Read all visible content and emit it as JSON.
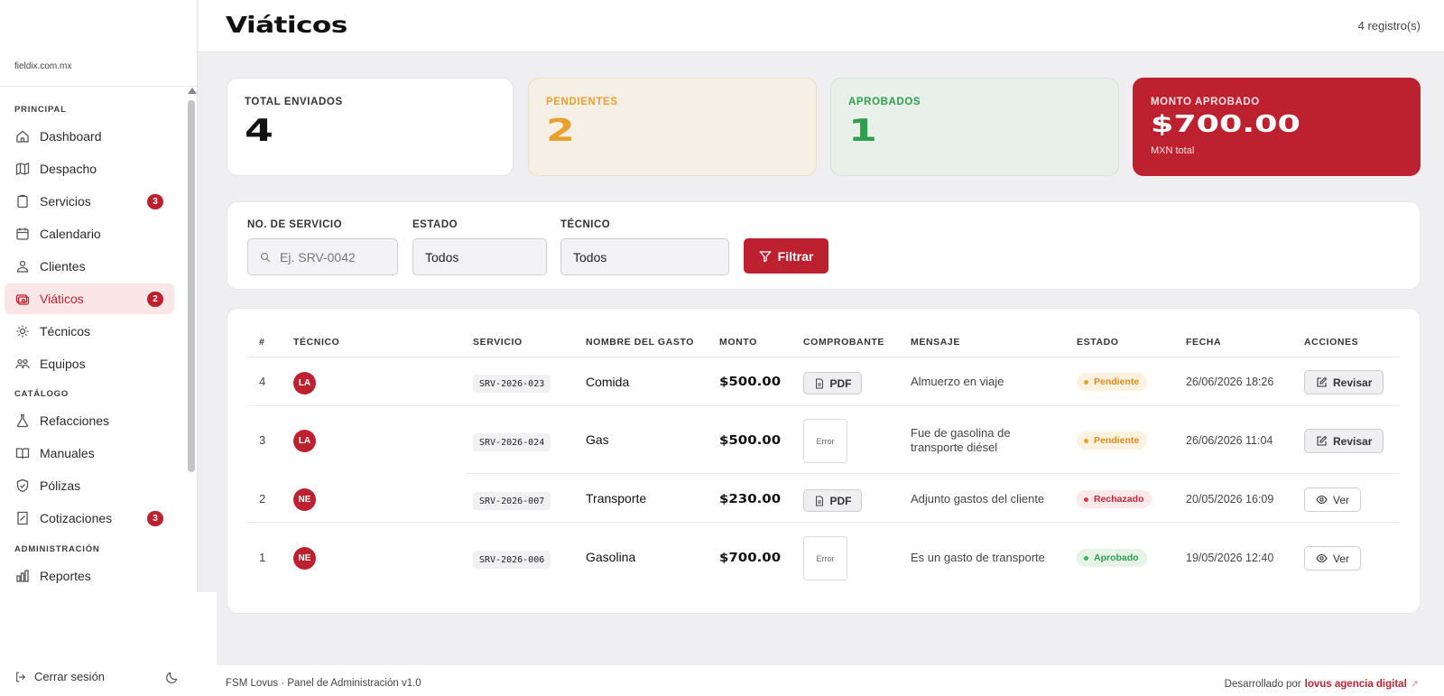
{
  "sidebar": {
    "domain": "fieldix.com.mx",
    "sections": {
      "principal": "PRINCIPAL",
      "catalogo": "CATÁLOGO",
      "administracion": "ADMINISTRACIÓN"
    },
    "items": [
      {
        "label": "Dashboard",
        "icon": "home-icon"
      },
      {
        "label": "Despacho",
        "icon": "map-icon"
      },
      {
        "label": "Servicios",
        "icon": "clipboard-icon",
        "badge": "3"
      },
      {
        "label": "Calendario",
        "icon": "calendar-icon"
      },
      {
        "label": "Clientes",
        "icon": "users-icon"
      },
      {
        "label": "Viáticos",
        "icon": "money-icon",
        "badge": "2",
        "active": true
      },
      {
        "label": "Técnicos",
        "icon": "gear-icon"
      },
      {
        "label": "Equipos",
        "icon": "team-icon"
      },
      {
        "label": "Refacciones",
        "icon": "flask-icon"
      },
      {
        "label": "Manuales",
        "icon": "book-icon"
      },
      {
        "label": "Pólizas",
        "icon": "shield-icon"
      },
      {
        "label": "Cotizaciones",
        "icon": "invoice-icon",
        "badge": "3"
      },
      {
        "label": "Reportes",
        "icon": "chart-icon"
      }
    ],
    "logout_label": "Cerrar sesión"
  },
  "header": {
    "title": "Viáticos",
    "record_count": "4 registro(s)"
  },
  "stats": {
    "total": {
      "label": "TOTAL ENVIADOS",
      "value": "4"
    },
    "pendientes": {
      "label": "PENDIENTES",
      "value": "2"
    },
    "aprobados": {
      "label": "APROBADOS",
      "value": "1"
    },
    "monto": {
      "label": "MONTO APROBADO",
      "value": "$700.00",
      "sub": "MXN total"
    }
  },
  "filters": {
    "servicio_label": "NO. DE SERVICIO",
    "servicio_placeholder": "Ej. SRV-0042",
    "estado_label": "ESTADO",
    "estado_value": "Todos",
    "tecnico_label": "TÉCNICO",
    "tecnico_value": "Todos",
    "button_label": "Filtrar"
  },
  "table": {
    "headers": [
      "#",
      "TÉCNICO",
      "SERVICIO",
      "NOMBRE DEL GASTO",
      "MONTO",
      "COMPROBANTE",
      "MENSAJE",
      "ESTADO",
      "FECHA",
      "ACCIONES"
    ],
    "rows": [
      {
        "num": "4",
        "tech": "LA",
        "service": "SRV-2026-023",
        "gasto": "Comida",
        "monto": "$500.00",
        "comprobante": "PDF",
        "mensaje": "Almuerzo en viaje",
        "estado": "Pendiente",
        "fecha": "26/06/2026 18:26",
        "accion": "Revisar"
      },
      {
        "num": "3",
        "tech": "LA",
        "service": "SRV-2026-024",
        "gasto": "Gas",
        "monto": "$500.00",
        "comprobante": "Error",
        "mensaje": "Fue de gasolina de transporte diésel",
        "estado": "Pendiente",
        "fecha": "26/06/2026 11:04",
        "accion": "Revisar"
      },
      {
        "num": "2",
        "tech": "NE",
        "service": "SRV-2026-007",
        "gasto": "Transporte",
        "monto": "$230.00",
        "comprobante": "PDF",
        "mensaje": "Adjunto gastos del cliente",
        "estado": "Rechazado",
        "fecha": "20/05/2026 16:09",
        "accion": "Ver"
      },
      {
        "num": "1",
        "tech": "NE",
        "service": "SRV-2026-006",
        "gasto": "Gasolina",
        "monto": "$700.00",
        "comprobante": "Error",
        "mensaje": "Es un gasto de transporte",
        "estado": "Aprobado",
        "fecha": "19/05/2026 12:40",
        "accion": "Ver"
      }
    ]
  },
  "footer": {
    "left": "FSM Lovus · Panel de Administración v1.0",
    "right_prefix": "Desarrollado por",
    "right_brand": "lovus agencia digital"
  },
  "colors": {
    "accent": "#bd2130",
    "pending": "#e8a02f",
    "approved": "#2f9e4e"
  }
}
